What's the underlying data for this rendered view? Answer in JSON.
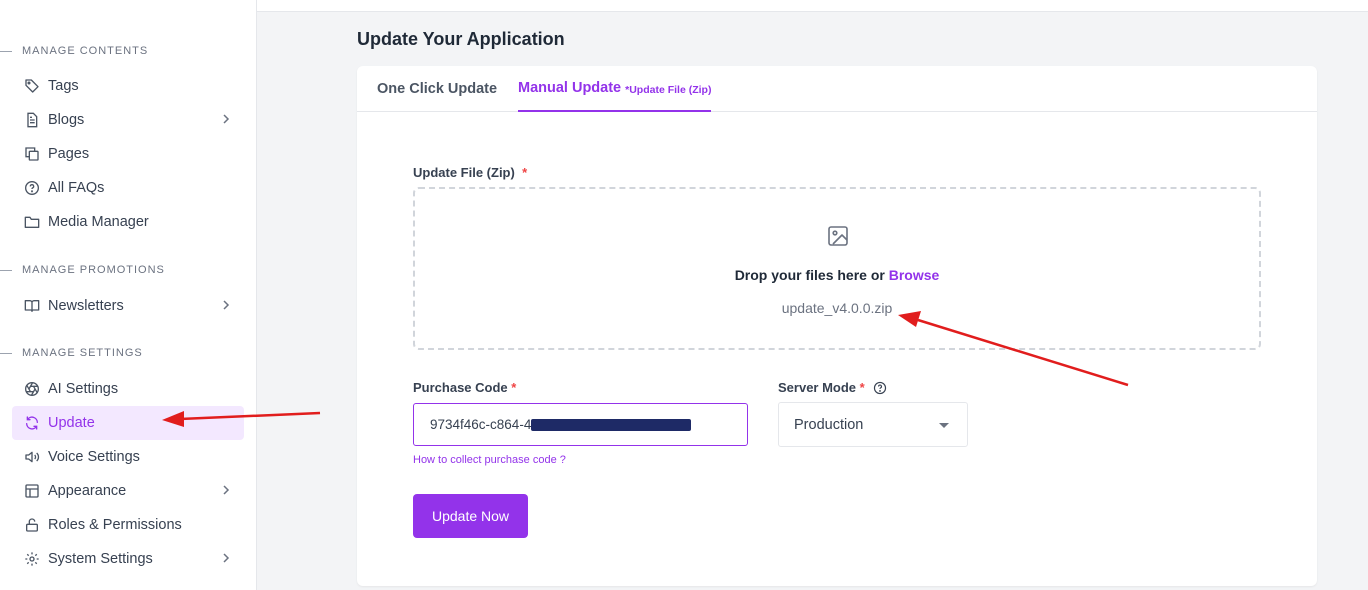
{
  "sidebar": {
    "sections": [
      {
        "title": "MANAGE CONTENTS"
      },
      {
        "title": "MANAGE PROMOTIONS"
      },
      {
        "title": "MANAGE SETTINGS"
      }
    ],
    "items": [
      {
        "label": "Tags",
        "icon": "tag-icon",
        "has_chevron": false
      },
      {
        "label": "Blogs",
        "icon": "document-icon",
        "has_chevron": true
      },
      {
        "label": "Pages",
        "icon": "pages-icon",
        "has_chevron": false
      },
      {
        "label": "All FAQs",
        "icon": "question-circle-icon",
        "has_chevron": false
      },
      {
        "label": "Media Manager",
        "icon": "folder-icon",
        "has_chevron": false
      },
      {
        "label": "Newsletters",
        "icon": "book-open-icon",
        "has_chevron": true
      },
      {
        "label": "AI Settings",
        "icon": "aperture-icon",
        "has_chevron": false
      },
      {
        "label": "Update",
        "icon": "refresh-icon",
        "has_chevron": false,
        "active": true
      },
      {
        "label": "Voice Settings",
        "icon": "speaker-icon",
        "has_chevron": false
      },
      {
        "label": "Appearance",
        "icon": "layout-icon",
        "has_chevron": true
      },
      {
        "label": "Roles & Permissions",
        "icon": "lock-icon",
        "has_chevron": false
      },
      {
        "label": "System Settings",
        "icon": "gear-icon",
        "has_chevron": true
      }
    ]
  },
  "page": {
    "title": "Update Your Application"
  },
  "tabs": [
    {
      "label": "One Click Update",
      "active": false
    },
    {
      "label": "Manual Update",
      "sub": "*Update File (Zip)",
      "active": true
    }
  ],
  "form": {
    "file_label": "Update File (Zip)",
    "required_mark": "*",
    "dropzone": {
      "text": "Drop your files here or",
      "browse": "Browse",
      "file_name": "update_v4.0.0.zip"
    },
    "purchase_code_label": "Purchase Code",
    "purchase_code_value": "9734f46c-c864-4",
    "help_link": "How to collect purchase code ?",
    "server_mode_label": "Server Mode",
    "server_mode_value": "Production",
    "submit_label": "Update Now"
  },
  "colors": {
    "accent": "#9333ea",
    "annotation_arrow": "#e11d1d"
  }
}
